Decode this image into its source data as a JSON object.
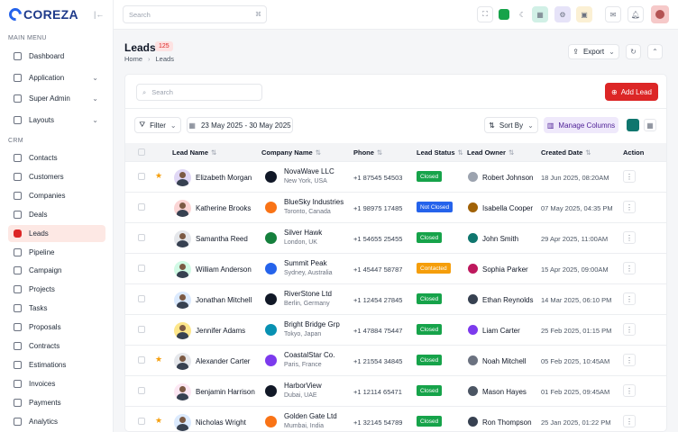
{
  "brand": {
    "name": "COREZA"
  },
  "sidebar": {
    "main_menu_label": "MAIN MENU",
    "main_items": [
      {
        "label": "Dashboard",
        "icon": "grid-icon"
      },
      {
        "label": "Application",
        "icon": "apps-icon",
        "has_children": true
      },
      {
        "label": "Super Admin",
        "icon": "user-shield-icon",
        "has_children": true
      },
      {
        "label": "Layouts",
        "icon": "layout-icon",
        "has_children": true
      }
    ],
    "crm_label": "CRM",
    "crm_items": [
      {
        "label": "Contacts",
        "icon": "contacts-icon"
      },
      {
        "label": "Customers",
        "icon": "customers-icon"
      },
      {
        "label": "Companies",
        "icon": "building-icon"
      },
      {
        "label": "Deals",
        "icon": "deals-icon"
      },
      {
        "label": "Leads",
        "icon": "leads-icon",
        "active": true
      },
      {
        "label": "Pipeline",
        "icon": "pipeline-icon"
      },
      {
        "label": "Campaign",
        "icon": "campaign-icon"
      },
      {
        "label": "Projects",
        "icon": "projects-icon"
      },
      {
        "label": "Tasks",
        "icon": "tasks-icon"
      },
      {
        "label": "Proposals",
        "icon": "proposals-icon"
      },
      {
        "label": "Contracts",
        "icon": "contracts-icon"
      },
      {
        "label": "Estimations",
        "icon": "estimations-icon"
      },
      {
        "label": "Invoices",
        "icon": "invoices-icon"
      },
      {
        "label": "Payments",
        "icon": "payments-icon"
      },
      {
        "label": "Analytics",
        "icon": "analytics-icon"
      }
    ]
  },
  "topbar": {
    "search_placeholder": "Search",
    "search_shortcut": "⌘"
  },
  "header": {
    "title": "Leads",
    "count": "125",
    "breadcrumb": [
      "Home",
      "Leads"
    ],
    "export_label": "Export"
  },
  "toolbar": {
    "search_placeholder": "Search",
    "add_label": "Add Lead",
    "filter_label": "Filter",
    "date_range": "23 May 2025 - 30 May 2025",
    "sort_label": "Sort By",
    "manage_columns_label": "Manage Columns"
  },
  "colors": {
    "accent": "#dc2626",
    "closed": "#16a34a",
    "not_closed": "#2563eb",
    "contacted": "#f59e0b"
  },
  "table": {
    "columns": [
      "Lead Name",
      "Company Name",
      "Phone",
      "Lead Status",
      "Lead Owner",
      "Created Date",
      "Action"
    ],
    "rows": [
      {
        "starred": true,
        "name": "Elizabeth Morgan",
        "company": "NovaWave LLC",
        "location": "New York, USA",
        "phone": "+1 87545 54503",
        "status": "Closed",
        "owner": "Robert Johnson",
        "created": "18 Jun 2025, 08:20AM"
      },
      {
        "starred": false,
        "name": "Katherine Brooks",
        "company": "BlueSky Industries",
        "location": "Toronto, Canada",
        "phone": "+1 98975 17485",
        "status": "Not Closed",
        "owner": "Isabella Cooper",
        "created": "07 May 2025, 04:35 PM"
      },
      {
        "starred": false,
        "name": "Samantha Reed",
        "company": "Silver Hawk",
        "location": "London, UK",
        "phone": "+1 54655 25455",
        "status": "Closed",
        "owner": "John Smith",
        "created": "29 Apr 2025, 11:00AM"
      },
      {
        "starred": false,
        "name": "William Anderson",
        "company": "Summit Peak",
        "location": "Sydney, Australia",
        "phone": "+1 45447 58787",
        "status": "Contacted",
        "owner": "Sophia Parker",
        "created": "15 Apr 2025, 09:00AM"
      },
      {
        "starred": false,
        "name": "Jonathan Mitchell",
        "company": "RiverStone Ltd",
        "location": "Berlin, Germany",
        "phone": "+1 12454 27845",
        "status": "Closed",
        "owner": "Ethan Reynolds",
        "created": "14 Mar 2025, 06:10 PM"
      },
      {
        "starred": false,
        "name": "Jennifer Adams",
        "company": "Bright Bridge Grp",
        "location": "Tokyo, Japan",
        "phone": "+1 47884 75447",
        "status": "Closed",
        "owner": "Liam Carter",
        "created": "25 Feb 2025, 01:15 PM"
      },
      {
        "starred": true,
        "name": "Alexander Carter",
        "company": "CoastalStar Co.",
        "location": "Paris, France",
        "phone": "+1 21554 34845",
        "status": "Closed",
        "owner": "Noah Mitchell",
        "created": "05 Feb 2025, 10:45AM"
      },
      {
        "starred": false,
        "name": "Benjamin Harrison",
        "company": "HarborView",
        "location": "Dubai, UAE",
        "phone": "+1 12114 65471",
        "status": "Closed",
        "owner": "Mason Hayes",
        "created": "01 Feb 2025, 09:45AM"
      },
      {
        "starred": true,
        "name": "Nicholas Wright",
        "company": "Golden Gate Ltd",
        "location": "Mumbai, India",
        "phone": "+1 32145 54789",
        "status": "Closed",
        "owner": "Ron Thompson",
        "created": "25 Jan 2025, 01:22 PM"
      }
    ]
  }
}
